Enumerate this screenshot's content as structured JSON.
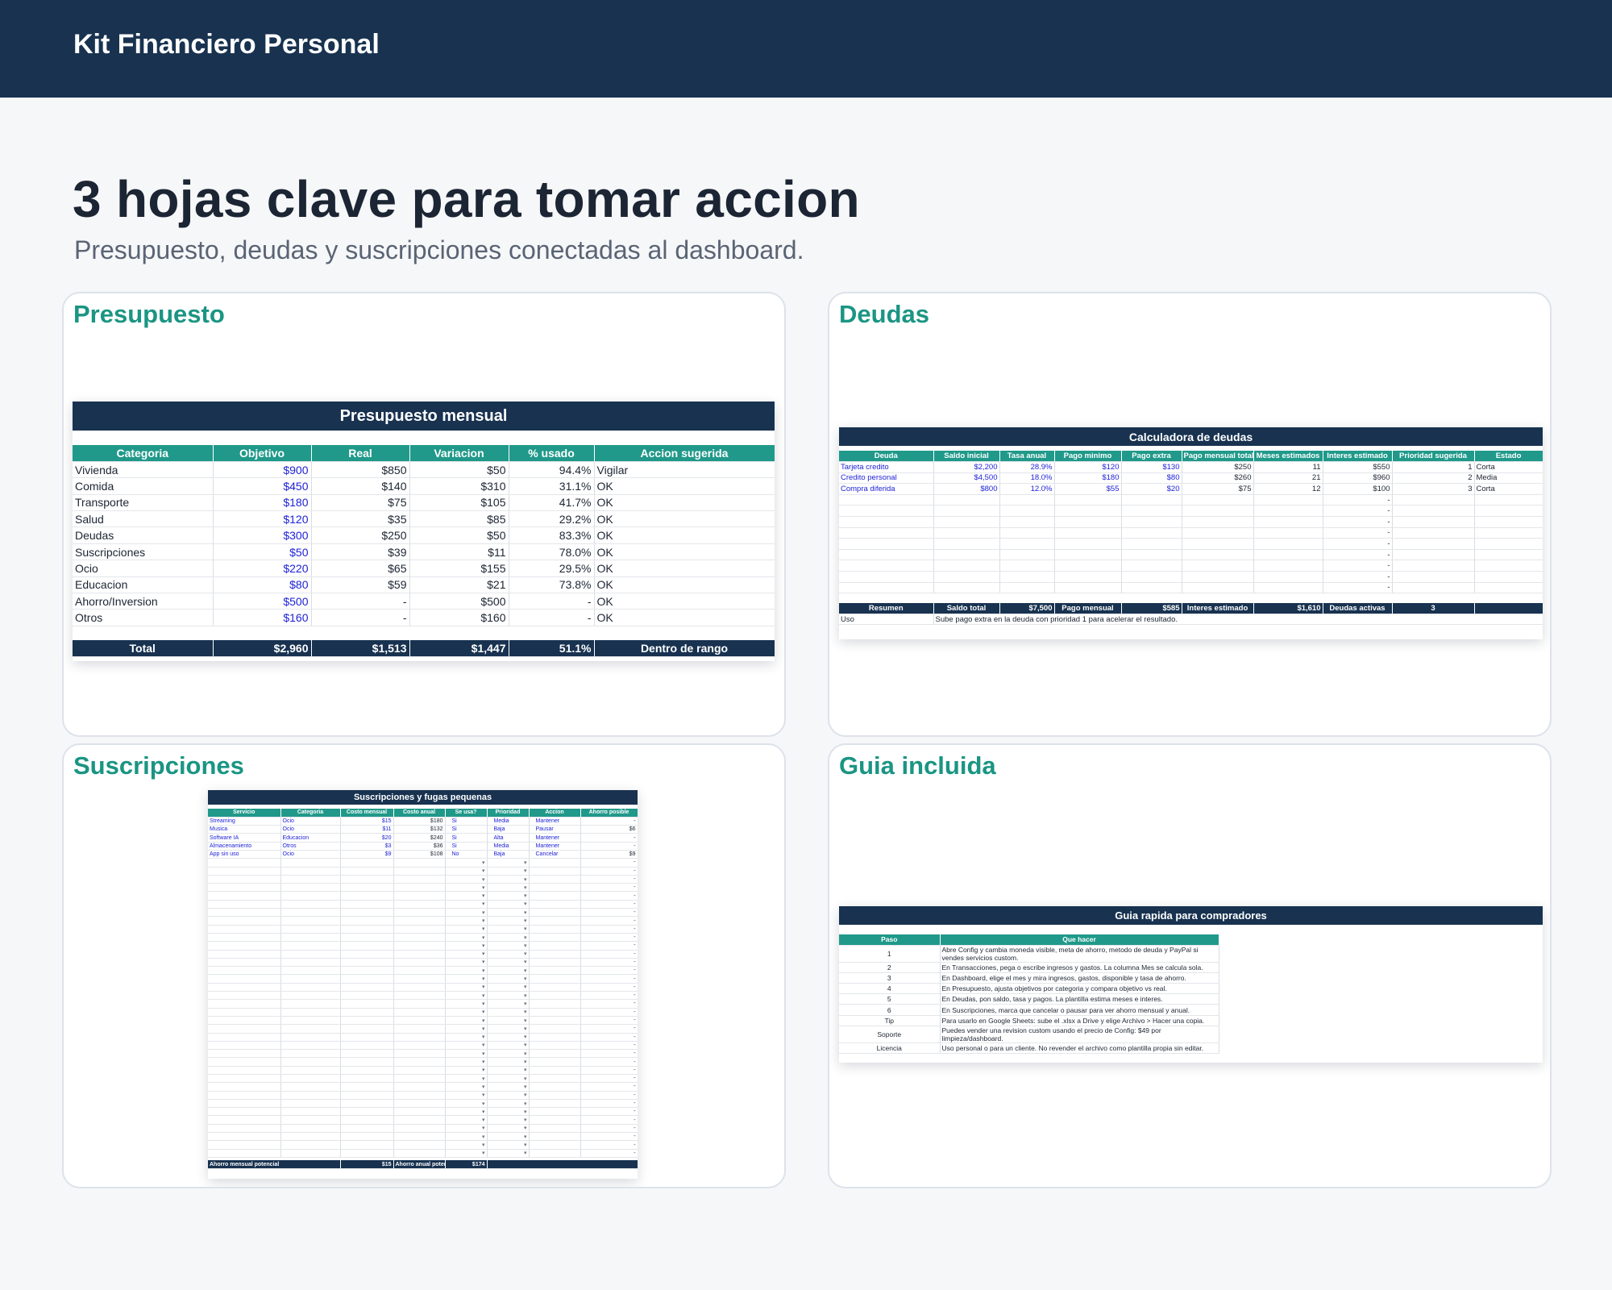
{
  "header": {
    "brand": "Kit Financiero Personal"
  },
  "hero": {
    "title": "3 hojas clave para tomar accion",
    "subtitle": "Presupuesto, deudas y suscripciones conectadas al dashboard."
  },
  "panels": {
    "presupuesto": "Presupuesto",
    "deudas": "Deudas",
    "suscripciones": "Suscripciones",
    "guia": "Guia incluida"
  },
  "presupuesto": {
    "title": "Presupuesto mensual",
    "columns": [
      "Categoria",
      "Objetivo",
      "Real",
      "Variacion",
      "% usado",
      "Accion sugerida"
    ],
    "rows": [
      [
        "Vivienda",
        "$900",
        "$850",
        "$50",
        "94.4%",
        "Vigilar"
      ],
      [
        "Comida",
        "$450",
        "$140",
        "$310",
        "31.1%",
        "OK"
      ],
      [
        "Transporte",
        "$180",
        "$75",
        "$105",
        "41.7%",
        "OK"
      ],
      [
        "Salud",
        "$120",
        "$35",
        "$85",
        "29.2%",
        "OK"
      ],
      [
        "Deudas",
        "$300",
        "$250",
        "$50",
        "83.3%",
        "OK"
      ],
      [
        "Suscripciones",
        "$50",
        "$39",
        "$11",
        "78.0%",
        "OK"
      ],
      [
        "Ocio",
        "$220",
        "$65",
        "$155",
        "29.5%",
        "OK"
      ],
      [
        "Educacion",
        "$80",
        "$59",
        "$21",
        "73.8%",
        "OK"
      ],
      [
        "Ahorro/Inversion",
        "$500",
        "-",
        "$500",
        "-",
        "OK"
      ],
      [
        "Otros",
        "$160",
        "-",
        "$160",
        "-",
        "OK"
      ]
    ],
    "total": [
      "Total",
      "$2,960",
      "$1,513",
      "$1,447",
      "51.1%",
      "Dentro de rango"
    ]
  },
  "deudas": {
    "title": "Calculadora de deudas",
    "columns": [
      "Deuda",
      "Saldo inicial",
      "Tasa anual",
      "Pago minimo",
      "Pago extra",
      "Pago mensual total",
      "Meses estimados",
      "Interes estimado",
      "Prioridad sugerida",
      "Estado"
    ],
    "rows": [
      [
        "Tarjeta credito",
        "$2,200",
        "28.9%",
        "$120",
        "$130",
        "$250",
        "11",
        "$550",
        "1",
        "Corta"
      ],
      [
        "Credito personal",
        "$4,500",
        "18.0%",
        "$180",
        "$80",
        "$260",
        "21",
        "$960",
        "2",
        "Media"
      ],
      [
        "Compra diferida",
        "$800",
        "12.0%",
        "$55",
        "$20",
        "$75",
        "12",
        "$100",
        "3",
        "Corta"
      ]
    ],
    "summary": [
      "Resumen",
      "Saldo total",
      "$7,500",
      "Pago mensual",
      "$585",
      "Interes estimado",
      "$1,610",
      "Deudas activas",
      "3",
      ""
    ],
    "note_label": "Uso",
    "note": "Sube pago extra en la deuda con prioridad 1 para acelerar el resultado."
  },
  "suscripciones": {
    "title": "Suscripciones y fugas pequenas",
    "columns": [
      "Servicio",
      "Categoria",
      "Costo mensual",
      "Costo anual",
      "Se usa?",
      "Prioridad",
      "Accion",
      "Ahorro posible"
    ],
    "rows": [
      [
        "Streaming",
        "Ocio",
        "$15",
        "$180",
        "Si",
        "Media",
        "Mantener",
        "-"
      ],
      [
        "Musica",
        "Ocio",
        "$11",
        "$132",
        "Si",
        "Baja",
        "Pausar",
        "$6"
      ],
      [
        "Software IA",
        "Educacion",
        "$20",
        "$240",
        "Si",
        "Alta",
        "Mantener",
        "-"
      ],
      [
        "Almacenamiento",
        "Otros",
        "$3",
        "$36",
        "Si",
        "Media",
        "Mantener",
        "-"
      ],
      [
        "App sin uso",
        "Ocio",
        "$9",
        "$108",
        "No",
        "Baja",
        "Cancelar",
        "$9"
      ]
    ],
    "footer": [
      "Ahorro mensual potencial",
      "$15",
      "Ahorro anual poter",
      "$174"
    ]
  },
  "guia": {
    "title": "Guia rapida para compradores",
    "columns": [
      "Paso",
      "Que hacer"
    ],
    "rows": [
      [
        "1",
        "Abre Config y cambia moneda visible, meta de ahorro, metodo de deuda y PayPal si vendes servicios custom."
      ],
      [
        "2",
        "En Transacciones, pega o escribe ingresos y gastos. La columna Mes se calcula sola."
      ],
      [
        "3",
        "En Dashboard, elige el mes y mira ingresos, gastos, disponible y tasa de ahorro."
      ],
      [
        "4",
        "En Presupuesto, ajusta objetivos por categoria y compara objetivo vs real."
      ],
      [
        "5",
        "En Deudas, pon saldo, tasa y pagos. La plantilla estima meses e interes."
      ],
      [
        "6",
        "En Suscripciones, marca que cancelar o pausar para ver ahorro mensual y anual."
      ],
      [
        "Tip",
        "Para usarlo en Google Sheets: sube el .xlsx a Drive y elige Archivo > Hacer una copia."
      ],
      [
        "Soporte",
        "Puedes vender una revision custom usando el precio de Config: $49 por limpieza/dashboard."
      ],
      [
        "Licencia",
        "Uso personal o para un cliente. No revender el archivo como plantilla propia sin editar."
      ]
    ]
  }
}
